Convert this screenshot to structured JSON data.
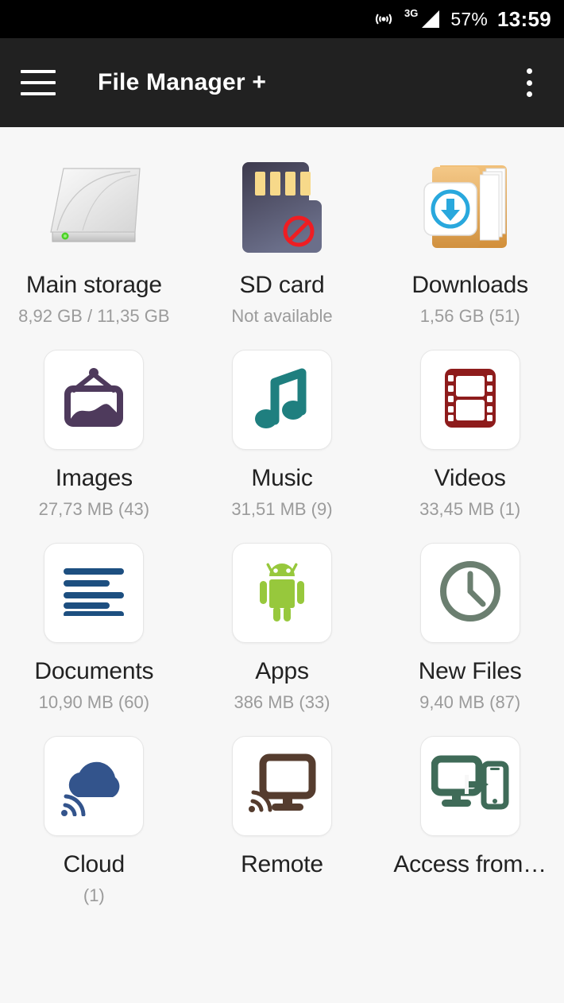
{
  "statusbar": {
    "hotspot_icon": "hotspot-icon",
    "network_label": "3G",
    "signal_icon": "signal-triangle-icon",
    "battery": "57%",
    "time": "13:59"
  },
  "toolbar": {
    "menu_icon": "hamburger-menu-icon",
    "title": "File Manager +",
    "overflow_icon": "overflow-menu-icon"
  },
  "theme": {
    "background": "#f7f7f7",
    "toolbar_bg": "#212121",
    "statusbar_bg": "#000000",
    "label_color": "#222222",
    "sub_color": "#9b9b9b"
  },
  "grid": {
    "tiles": [
      {
        "id": "main-storage",
        "icon": "hard-drive-icon",
        "label": "Main storage",
        "sub": "8,92 GB / 11,35 GB",
        "color": "#d8d8d8"
      },
      {
        "id": "sd-card",
        "icon": "sd-card-icon",
        "label": "SD card",
        "sub": "Not available",
        "color": "#4d4a5e"
      },
      {
        "id": "downloads",
        "icon": "download-folder-icon",
        "label": "Downloads",
        "sub": "1,56 GB (51)",
        "color": "#e8a951"
      },
      {
        "id": "images",
        "icon": "picture-frame-icon",
        "label": "Images",
        "sub": "27,73 MB (43)",
        "color": "#4e3a5c"
      },
      {
        "id": "music",
        "icon": "music-note-icon",
        "label": "Music",
        "sub": "31,51 MB (9)",
        "color": "#1f7f7f"
      },
      {
        "id": "videos",
        "icon": "film-strip-icon",
        "label": "Videos",
        "sub": "33,45 MB (1)",
        "color": "#8e1c1c"
      },
      {
        "id": "documents",
        "icon": "document-lines-icon",
        "label": "Documents",
        "sub": "10,90 MB (60)",
        "color": "#1d4f80"
      },
      {
        "id": "apps",
        "icon": "android-robot-icon",
        "label": "Apps",
        "sub": "386 MB (33)",
        "color": "#97c83c"
      },
      {
        "id": "new-files",
        "icon": "clock-icon",
        "label": "New Files",
        "sub": "9,40 MB (87)",
        "color": "#6b7f70"
      },
      {
        "id": "cloud",
        "icon": "cloud-wifi-icon",
        "label": "Cloud",
        "sub": "(1)",
        "color": "#33548c"
      },
      {
        "id": "remote",
        "icon": "monitor-wifi-icon",
        "label": "Remote",
        "sub": "",
        "color": "#553c2e"
      },
      {
        "id": "access-from",
        "icon": "monitor-to-phone-icon",
        "label": "Access from…",
        "sub": "",
        "color": "#3f6b58"
      }
    ]
  }
}
